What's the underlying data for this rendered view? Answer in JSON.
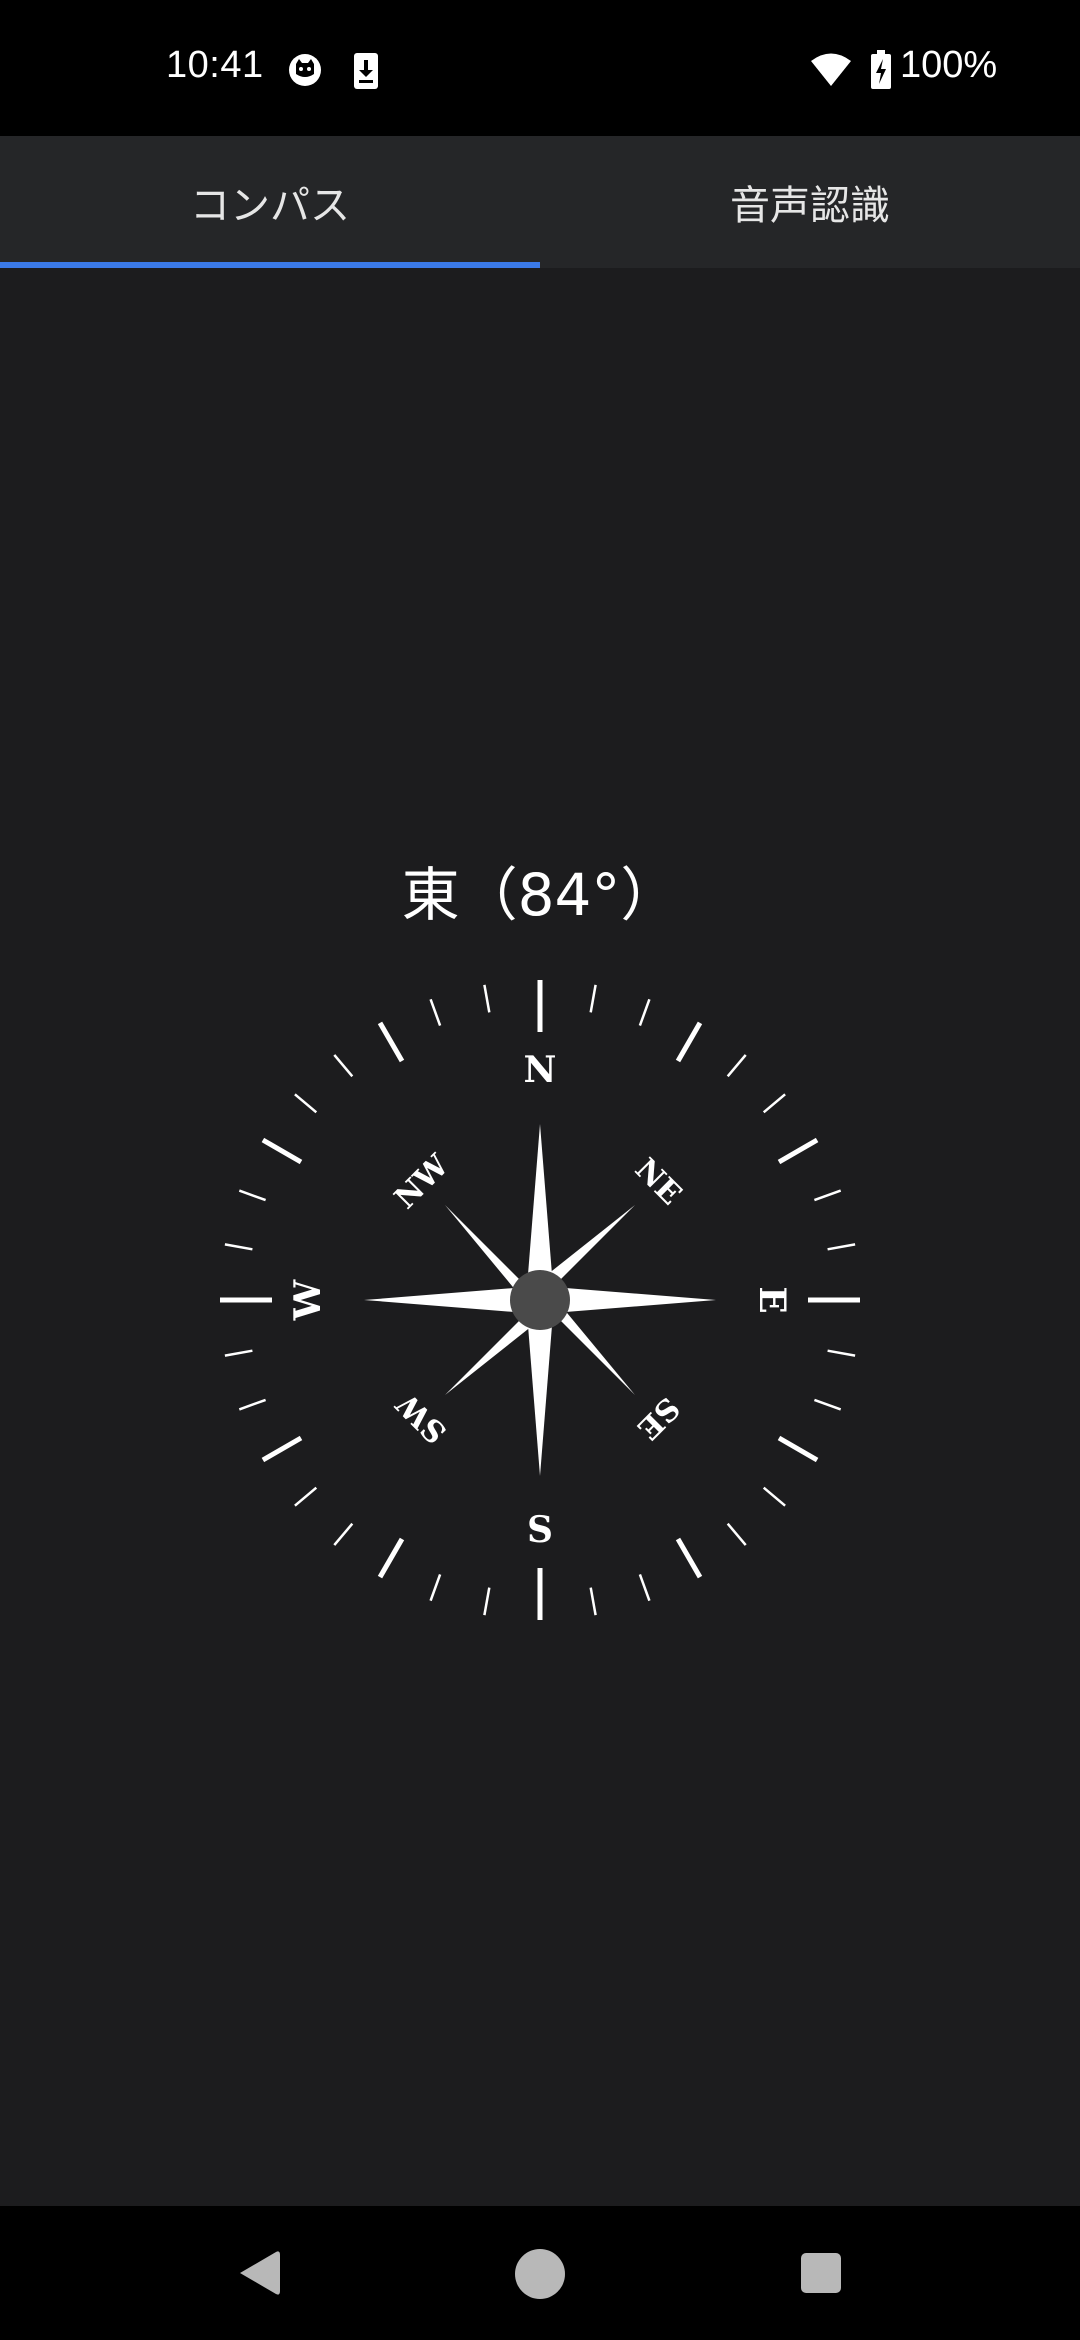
{
  "status_bar": {
    "time": "10:41",
    "battery_text": "100%",
    "icons": [
      "cat-icon",
      "download-icon",
      "wifi-icon",
      "battery-charging-icon"
    ]
  },
  "tabs": [
    {
      "label": "コンパス",
      "active": true
    },
    {
      "label": "音声認識",
      "active": false
    }
  ],
  "compass": {
    "heading_text": "東（84°）",
    "heading_degrees": 84,
    "labels": {
      "n": "N",
      "ne": "NE",
      "e": "E",
      "se": "SE",
      "s": "S",
      "sw": "SW",
      "w": "W",
      "nw": "NW"
    },
    "needle_colors": {
      "north_tip": "#e53935",
      "south_tip": "#b0b0b0"
    }
  },
  "nav_bar": {
    "buttons": [
      "back-icon",
      "home-icon",
      "recents-icon"
    ]
  },
  "colors": {
    "background": "#1c1c1e",
    "tab_bar": "#252628",
    "tab_indicator": "#3b7ae8"
  }
}
